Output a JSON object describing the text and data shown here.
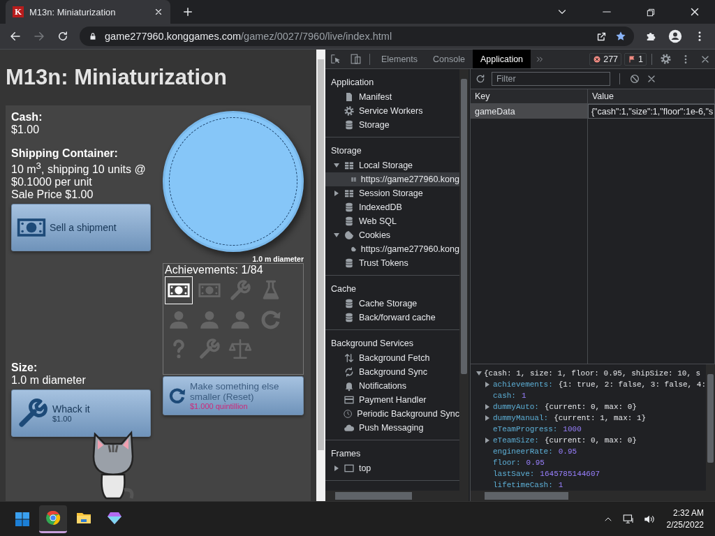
{
  "browser": {
    "tab": {
      "favicon": "K",
      "title": "M13n: Miniaturization"
    },
    "url_host": "game277960.konggames.com",
    "url_path": "/gamez/0027/7960/live/index.html"
  },
  "game": {
    "title": "M13n: Miniaturization",
    "cash_label": "Cash:",
    "cash": "$1.00",
    "container_label": "Shipping Container:",
    "container_text": "10 m$^{3}$, shipping 10 units @ $0.1000 per unit",
    "sale_price": "Sale Price $1.00",
    "sell_button": "Sell a shipment",
    "diameter_caption": "1.0 m diameter",
    "achievements_title": "Achievements: 1/84",
    "achievements": [
      {
        "kind": "cash",
        "unlocked": true
      },
      {
        "kind": "cash",
        "unlocked": false
      },
      {
        "kind": "wrench",
        "unlocked": false
      },
      {
        "kind": "flask",
        "unlocked": false
      },
      {
        "kind": "person",
        "unlocked": false
      },
      {
        "kind": "person",
        "unlocked": false
      },
      {
        "kind": "person",
        "unlocked": false
      },
      {
        "kind": "reset",
        "unlocked": false
      },
      {
        "kind": "question",
        "unlocked": false
      },
      {
        "kind": "wrench",
        "unlocked": false
      },
      {
        "kind": "scale",
        "unlocked": false
      }
    ],
    "size_label": "Size:",
    "size": "1.0 m diameter",
    "whack_button": {
      "label": "Whack it",
      "cost": "$1.00"
    },
    "reset_button": {
      "label": "Make something else smaller (Reset)",
      "cost": "$1.000 quintillion",
      "disabled": true
    }
  },
  "devtools": {
    "tabs": [
      {
        "label": "Elements",
        "selected": false
      },
      {
        "label": "Console",
        "selected": false
      },
      {
        "label": "Application",
        "selected": true
      }
    ],
    "errors": "277",
    "issues": "1",
    "sidebar": [
      {
        "title": "Application",
        "items": [
          {
            "label": "Manifest",
            "kind": "file",
            "selected": false
          },
          {
            "label": "Service Workers",
            "kind": "gear",
            "selected": false
          },
          {
            "label": "Storage",
            "kind": "database",
            "selected": false
          }
        ]
      },
      {
        "title": "Storage",
        "items": [
          {
            "label": "Local Storage",
            "kind": "grid",
            "expanded": true,
            "selected": false,
            "children": [
              {
                "label": "https://game277960.kong",
                "kind": "grid",
                "selected": true
              }
            ]
          },
          {
            "label": "Session Storage",
            "kind": "grid",
            "expanded": false,
            "selected": false
          },
          {
            "label": "IndexedDB",
            "kind": "database",
            "selected": false
          },
          {
            "label": "Web SQL",
            "kind": "database",
            "selected": false
          },
          {
            "label": "Cookies",
            "kind": "cookie",
            "expanded": true,
            "selected": false,
            "children": [
              {
                "label": "https://game277960.kong",
                "kind": "cookie",
                "selected": false
              }
            ]
          },
          {
            "label": "Trust Tokens",
            "kind": "database",
            "selected": false
          }
        ]
      },
      {
        "title": "Cache",
        "items": [
          {
            "label": "Cache Storage",
            "kind": "database",
            "selected": false
          },
          {
            "label": "Back/forward cache",
            "kind": "database",
            "selected": false
          }
        ]
      },
      {
        "title": "Background Services",
        "items": [
          {
            "label": "Background Fetch",
            "kind": "arrows",
            "selected": false
          },
          {
            "label": "Background Sync",
            "kind": "sync",
            "selected": false
          },
          {
            "label": "Notifications",
            "kind": "bell",
            "selected": false
          },
          {
            "label": "Payment Handler",
            "kind": "card",
            "selected": false
          },
          {
            "label": "Periodic Background Sync",
            "kind": "clock",
            "selected": false
          },
          {
            "label": "Push Messaging",
            "kind": "cloud",
            "selected": false
          }
        ]
      },
      {
        "title": "Frames",
        "items": [
          {
            "label": "top",
            "kind": "frame",
            "expanded": false,
            "selected": false
          }
        ]
      }
    ],
    "filter_placeholder": "Filter",
    "columns": [
      "Key",
      "Value"
    ],
    "rows": [
      {
        "key": "gameData",
        "value": "{\"cash\":1,\"size\":1,\"floor\":1e-6,\"s",
        "selected": true
      }
    ],
    "preview": {
      "summary": "{cash: 1, size: 1, floor: 0.95, shipSize: 10, s",
      "expanded": true,
      "properties": [
        {
          "key": "achievements:",
          "value": "{1: true, 2: false, 3: false, 4:",
          "kind": "object",
          "expanded": false
        },
        {
          "key": "cash:",
          "value": "1",
          "kind": "number"
        },
        {
          "key": "dummyAuto:",
          "value": "{current: 0, max: 0}",
          "kind": "object",
          "expanded": false
        },
        {
          "key": "dummyManual:",
          "value": "{current: 1, max: 1}",
          "kind": "object",
          "expanded": false
        },
        {
          "key": "eTeamProgress:",
          "value": "1000",
          "kind": "number"
        },
        {
          "key": "eTeamSize:",
          "value": "{current: 0, max: 0}",
          "kind": "object",
          "expanded": false
        },
        {
          "key": "engineerRate:",
          "value": "0.95",
          "kind": "number"
        },
        {
          "key": "floor:",
          "value": "0.95",
          "kind": "number"
        },
        {
          "key": "lastSave:",
          "value": "1645785144607",
          "kind": "number"
        },
        {
          "key": "lifetimeCash:",
          "value": "1",
          "kind": "number"
        }
      ]
    }
  },
  "taskbar": {
    "apps": [
      {
        "kind": "chrome",
        "selected": true
      },
      {
        "kind": "folder",
        "selected": false
      },
      {
        "kind": "gem",
        "selected": false
      }
    ],
    "time": "2:32 AM",
    "date": "2/25/2022"
  }
}
